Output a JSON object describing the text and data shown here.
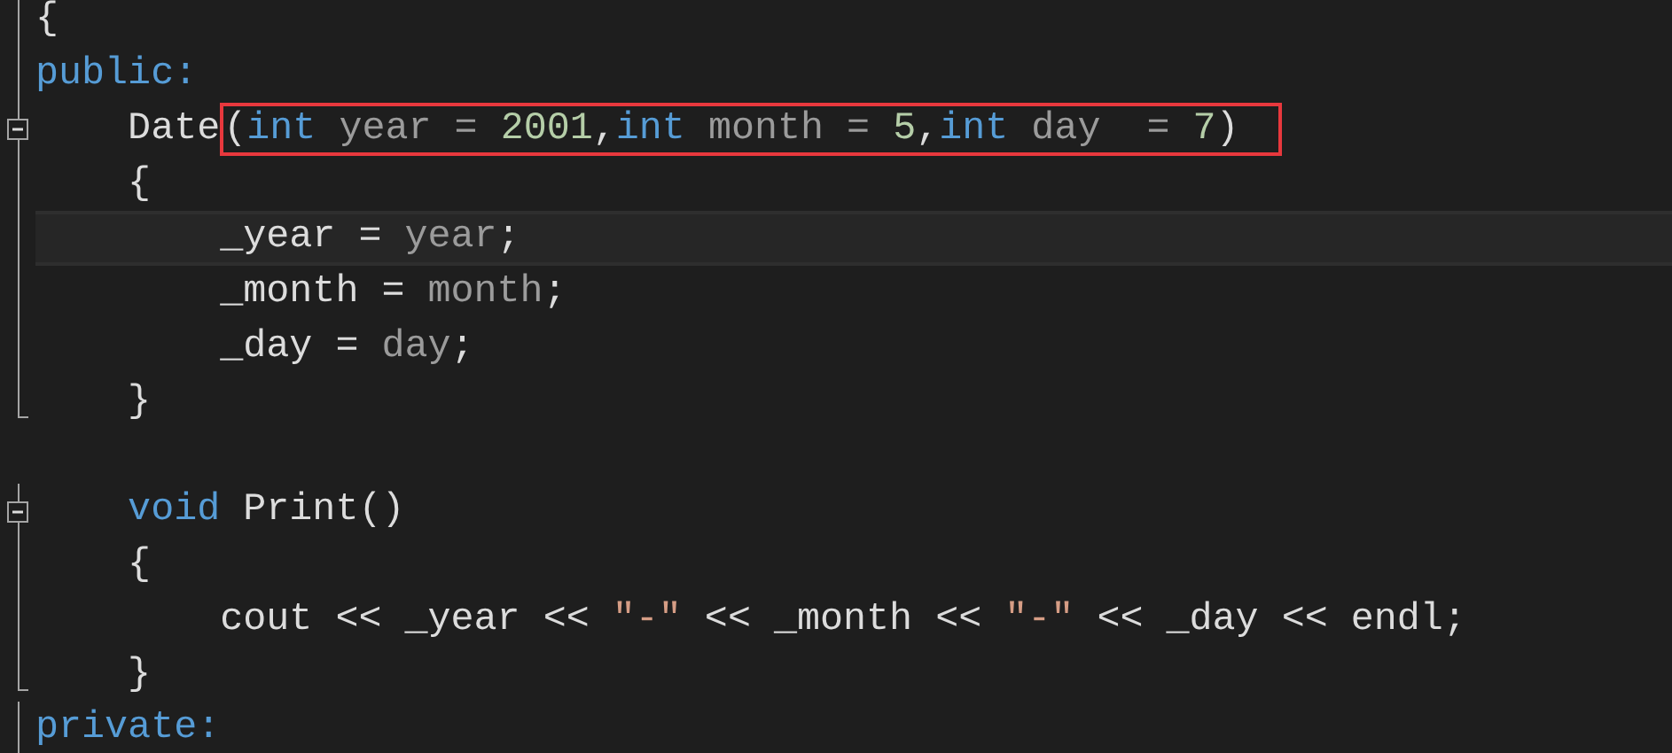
{
  "lines": [
    {
      "guide": true,
      "collapsible": false,
      "block_end": false,
      "current": false,
      "tokens": [
        {
          "text": "{",
          "kind": "plain"
        }
      ]
    },
    {
      "guide": true,
      "collapsible": false,
      "block_end": false,
      "current": false,
      "tokens": [
        {
          "text": "public:",
          "kind": "keyword"
        }
      ]
    },
    {
      "guide": true,
      "collapsible": true,
      "block_end": false,
      "current": false,
      "tokens": [
        {
          "text": "    Date",
          "kind": "plain"
        }
      ],
      "box": [
        {
          "text": "(",
          "kind": "plain"
        },
        {
          "text": "int",
          "kind": "keyword"
        },
        {
          "text": " year = ",
          "kind": "param"
        },
        {
          "text": "2001",
          "kind": "number"
        },
        {
          "text": ",",
          "kind": "plain"
        },
        {
          "text": "int",
          "kind": "keyword"
        },
        {
          "text": " month = ",
          "kind": "param"
        },
        {
          "text": "5",
          "kind": "number"
        },
        {
          "text": ",",
          "kind": "plain"
        },
        {
          "text": "int",
          "kind": "keyword"
        },
        {
          "text": " day  = ",
          "kind": "param"
        },
        {
          "text": "7",
          "kind": "number"
        },
        {
          "text": ")",
          "kind": "plain"
        }
      ]
    },
    {
      "guide": true,
      "collapsible": false,
      "block_end": false,
      "current": false,
      "tokens": [
        {
          "text": "    {",
          "kind": "plain"
        }
      ]
    },
    {
      "guide": true,
      "collapsible": false,
      "block_end": false,
      "current": true,
      "tokens": [
        {
          "text": "        _year = ",
          "kind": "plain"
        },
        {
          "text": "year",
          "kind": "param"
        },
        {
          "text": ";",
          "kind": "plain"
        }
      ]
    },
    {
      "guide": true,
      "collapsible": false,
      "block_end": false,
      "current": false,
      "tokens": [
        {
          "text": "        _month = ",
          "kind": "plain"
        },
        {
          "text": "month",
          "kind": "param"
        },
        {
          "text": ";",
          "kind": "plain"
        }
      ]
    },
    {
      "guide": true,
      "collapsible": false,
      "block_end": false,
      "current": false,
      "tokens": [
        {
          "text": "        _day = ",
          "kind": "plain"
        },
        {
          "text": "day",
          "kind": "param"
        },
        {
          "text": ";",
          "kind": "plain"
        }
      ]
    },
    {
      "guide": true,
      "collapsible": false,
      "block_end": true,
      "current": false,
      "tokens": [
        {
          "text": "    }",
          "kind": "plain"
        }
      ]
    },
    {
      "guide": false,
      "collapsible": false,
      "block_end": false,
      "current": false
    },
    {
      "guide": true,
      "collapsible": true,
      "block_end": false,
      "current": false,
      "tokens": [
        {
          "text": "    void",
          "kind": "keyword"
        },
        {
          "text": " Print()",
          "kind": "plain"
        }
      ]
    },
    {
      "guide": true,
      "collapsible": false,
      "block_end": false,
      "current": false,
      "tokens": [
        {
          "text": "    {",
          "kind": "plain"
        }
      ]
    },
    {
      "guide": true,
      "collapsible": false,
      "block_end": false,
      "current": false,
      "tokens": [
        {
          "text": "        cout << _year << ",
          "kind": "plain"
        },
        {
          "text": "\"-\"",
          "kind": "string"
        },
        {
          "text": " << _month << ",
          "kind": "plain"
        },
        {
          "text": "\"-\"",
          "kind": "string"
        },
        {
          "text": " << _day << endl;",
          "kind": "plain"
        }
      ]
    },
    {
      "guide": true,
      "collapsible": false,
      "block_end": true,
      "current": false,
      "tokens": [
        {
          "text": "    }",
          "kind": "plain"
        }
      ]
    },
    {
      "guide": true,
      "collapsible": false,
      "block_end": false,
      "current": false,
      "tokens": [
        {
          "text": "private:",
          "kind": "keyword"
        }
      ]
    }
  ]
}
